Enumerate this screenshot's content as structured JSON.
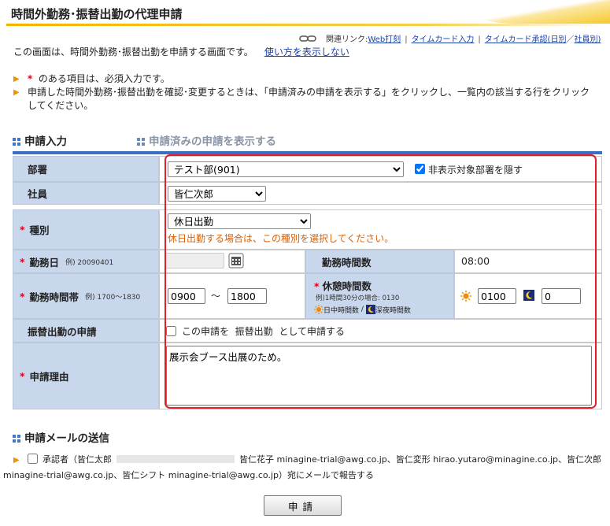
{
  "title": "時間外勤務･振替出勤の代理申請",
  "related": {
    "label": "関連リンク:",
    "items": [
      "Web打刻",
      "タイムカード入力",
      "タイムカード承認(日別",
      "社員別)"
    ],
    "slash": "／"
  },
  "intro": {
    "text": "この画面は、時間外勤務･振替出勤を申請する画面です。",
    "toggle_link": "使い方を表示しない"
  },
  "notes": {
    "required_star": "*",
    "required_text": "のある項目は、必須入力です。",
    "second": "申請した時間外勤務･振替出勤を確認･変更するときは、「申請済みの申請を表示する」をクリックし、一覧内の該当する行をクリックしてください。"
  },
  "tabs": {
    "active": "申請入力",
    "other": "申請済みの申請を表示する"
  },
  "form": {
    "department": {
      "label": "部署",
      "value": "テスト部(901)",
      "hide_label": "非表示対象部署を隠す",
      "hide_checked": true
    },
    "employee": {
      "label": "社員",
      "value": "皆仁次郎"
    },
    "type": {
      "label": "種別",
      "value": "休日出勤",
      "hint": "休日出勤する場合は、この種別を選択してください。"
    },
    "work_date": {
      "label": "勤務日",
      "example": "例) 20090401",
      "value": ""
    },
    "work_hours": {
      "label": "勤務時間数",
      "value": "08:00"
    },
    "work_band": {
      "label": "勤務時間帯",
      "example": "例) 1700～1830",
      "from": "0900",
      "tilde": "～",
      "to": "1800"
    },
    "break": {
      "label": "休憩時間数",
      "example": "例)1時間30分の場合: 0130",
      "day_label": "日中時間数",
      "sep": "/",
      "night_label": "深夜時間数",
      "day_value": "0100",
      "night_value": "0"
    },
    "substitute": {
      "label": "振替出勤の申請",
      "text1": "この申請を",
      "text2": "振替出勤",
      "text3": "として申請する"
    },
    "reason": {
      "label": "申請理由",
      "value": "展示会ブース出展のため。"
    },
    "required_star": "*"
  },
  "mail": {
    "heading": "申請メールの送信",
    "line1_a": "承認者（皆仁太郎",
    "line1_b": "皆仁花子 minagine-trial@awg.co.jp、皆仁変形 hirao.yutaro@minagine.co.jp、皆仁次郎",
    "line2": "minagine-trial@awg.co.jp、皆仁シフト minagine-trial@awg.co.jp）宛にメールで報告する"
  },
  "submit_label": "申請",
  "colors": {
    "accent": "#3b6fc1",
    "label_bg": "#c8d7ec",
    "required": "#e0001a",
    "hint": "#e06000",
    "highlight": "#e2202a"
  },
  "icons": {
    "links": "chain-link-icon",
    "calendar": "calendar-icon",
    "sun": "sun-icon",
    "moon": "moon-icon",
    "bullet": "triangle-bullet-icon"
  }
}
